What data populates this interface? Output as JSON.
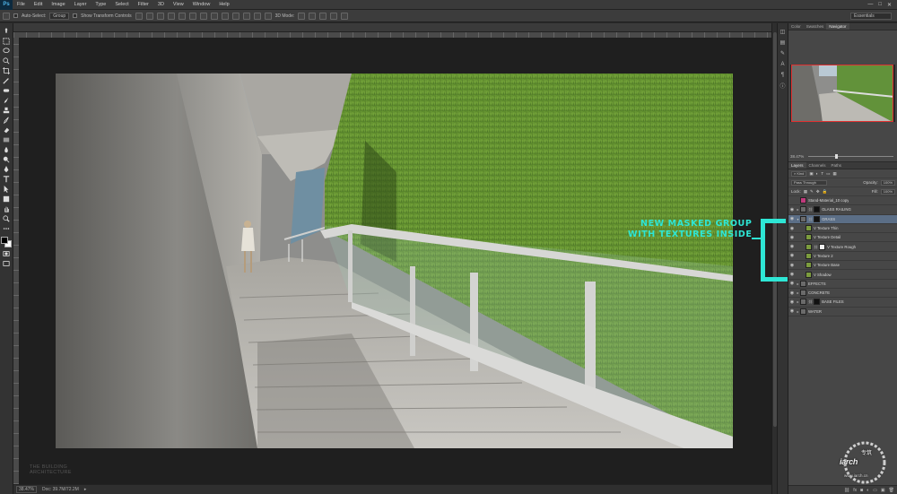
{
  "app": {
    "logo": "Ps"
  },
  "menu": [
    "File",
    "Edit",
    "Image",
    "Layer",
    "Type",
    "Select",
    "Filter",
    "3D",
    "View",
    "Window",
    "Help"
  ],
  "window_controls": [
    "—",
    "□",
    "✕"
  ],
  "options_bar": {
    "auto_select_label": "Auto-Select:",
    "auto_select_value": "Group",
    "transform_label": "Show Transform Controls",
    "mode_3d_label": "3D Mode:",
    "workspace": "Essentials"
  },
  "status": {
    "zoom": "38.47%",
    "doc": "Doc: 39.7M/72.2M"
  },
  "canvas_watermark": [
    "THE BUILDING",
    "ARCHITECTURE"
  ],
  "panels": {
    "top_tabs": [
      "Color",
      "Swatches",
      "Navigator"
    ],
    "top_active": "Navigator",
    "nav_zoom": "38.47%",
    "layer_tabs": [
      "Layers",
      "Channels",
      "Paths"
    ],
    "kind_label": "Kind",
    "blend_mode": "Pass Through",
    "opacity_label": "Opacity:",
    "opacity": "100%",
    "lock_label": "Lock:",
    "fill_label": "Fill:",
    "fill": "100%"
  },
  "layers": [
    {
      "name": "Stand-Material_10 copy",
      "visible": false,
      "indent": 0,
      "toggle": "",
      "thumb": "pink",
      "mask": false,
      "selected": false
    },
    {
      "name": "GLASS RAILING",
      "visible": true,
      "indent": 0,
      "toggle": "▸",
      "thumb": "folder",
      "mask": true,
      "selected": false
    },
    {
      "name": "GRASS",
      "visible": true,
      "indent": 0,
      "toggle": "▾",
      "thumb": "folder",
      "mask": true,
      "selected": true
    },
    {
      "name": "V Texture Thin",
      "visible": true,
      "indent": 1,
      "toggle": "",
      "thumb": "green",
      "mask": false,
      "selected": false
    },
    {
      "name": "V Texture Detail",
      "visible": true,
      "indent": 1,
      "toggle": "",
      "thumb": "green",
      "mask": false,
      "selected": false
    },
    {
      "name": "V Texture Rough",
      "visible": true,
      "indent": 1,
      "toggle": "",
      "thumb": "green",
      "mask": true,
      "selected": false
    },
    {
      "name": "V Texture 2",
      "visible": true,
      "indent": 1,
      "toggle": "",
      "thumb": "green",
      "mask": false,
      "selected": false
    },
    {
      "name": "V Texture Base",
      "visible": true,
      "indent": 1,
      "toggle": "",
      "thumb": "green",
      "mask": false,
      "selected": false
    },
    {
      "name": "V Shadow",
      "visible": true,
      "indent": 1,
      "toggle": "",
      "thumb": "green",
      "mask": false,
      "selected": false
    },
    {
      "name": "EFFECTS",
      "visible": true,
      "indent": 0,
      "toggle": "▸",
      "thumb": "folder",
      "mask": false,
      "selected": false
    },
    {
      "name": "CONCRETE",
      "visible": true,
      "indent": 0,
      "toggle": "▸",
      "thumb": "folder",
      "mask": false,
      "selected": false
    },
    {
      "name": "BASE FILES",
      "visible": true,
      "indent": 0,
      "toggle": "▸",
      "thumb": "folder",
      "mask": true,
      "selected": false
    },
    {
      "name": "WATER",
      "visible": true,
      "indent": 0,
      "toggle": "▸",
      "thumb": "folder",
      "mask": false,
      "selected": false
    }
  ],
  "annotation": [
    "NEW MASKED GROUP",
    "WITH TEXTURES INSIDE"
  ],
  "site_logo": {
    "text": "iarch",
    "cn": "专筑",
    "url": "www.iarch.cn"
  },
  "colors": {
    "annotation": "#2ee6d5",
    "selection": "#5b6e86",
    "navigator_box": "#e03030"
  }
}
